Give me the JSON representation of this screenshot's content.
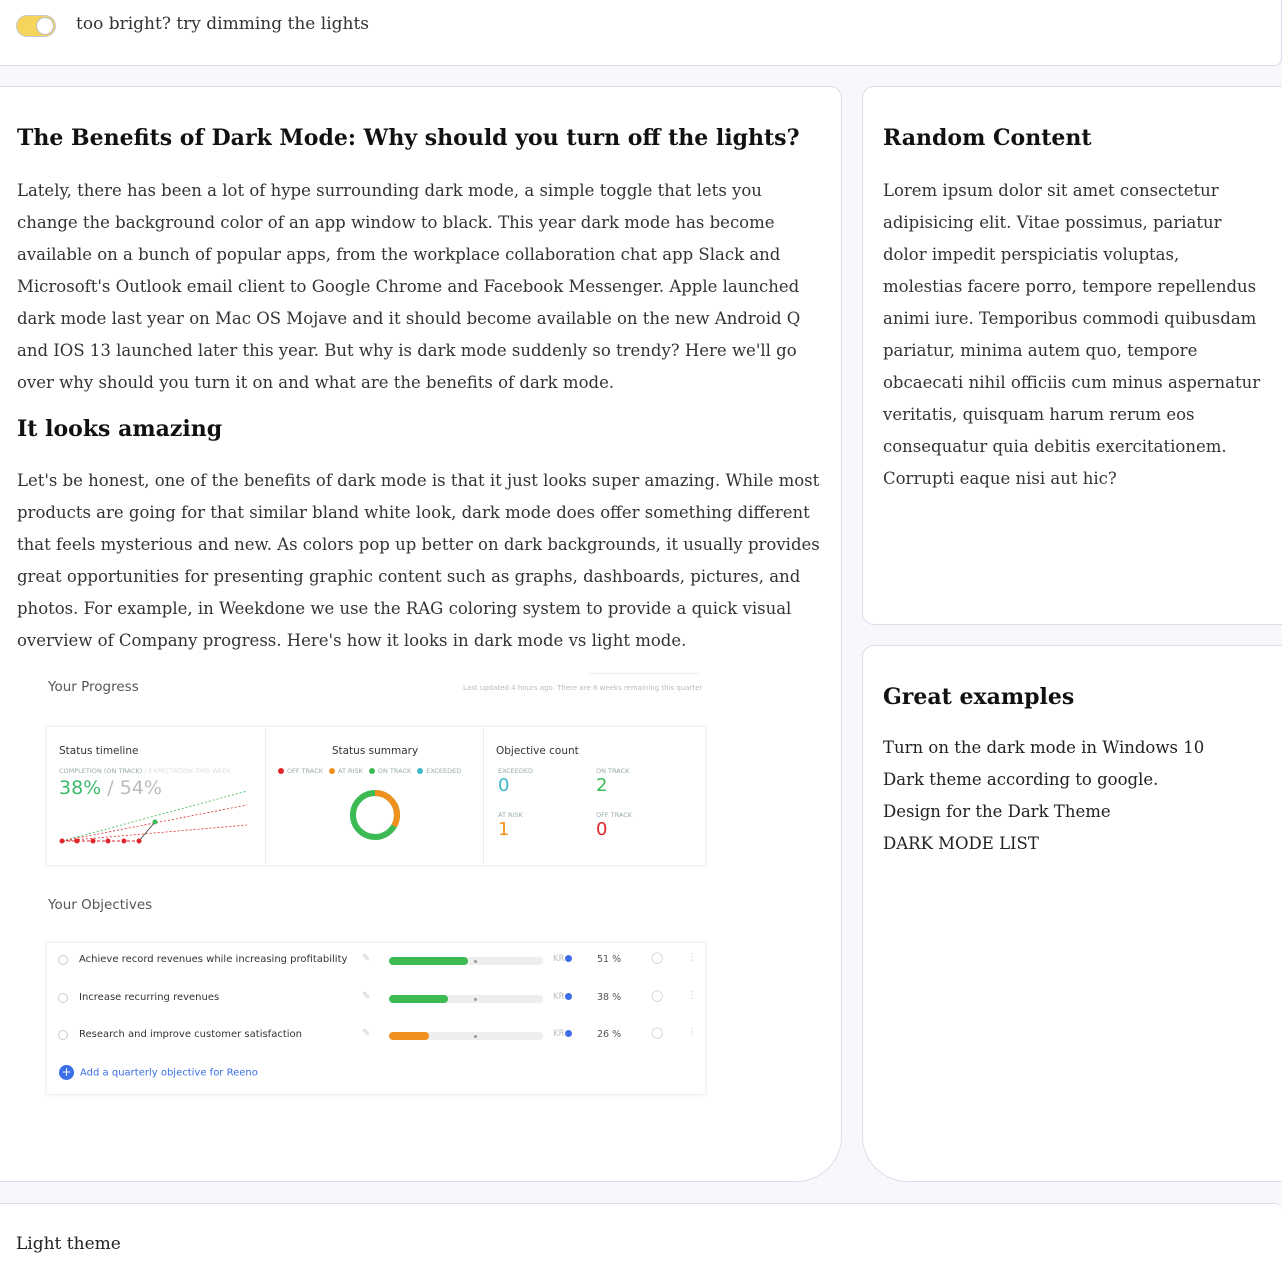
{
  "topbar": {
    "toggle_label": "too bright? try dimming the lights",
    "toggle_on": true
  },
  "main": {
    "title": "The Benefits of Dark Mode: Why should you turn off the lights?",
    "intro": "Lately, there has been a lot of hype surrounding dark mode, a simple toggle that lets you change the background color of an app window to black. This year dark mode has become available on a bunch of popular apps, from the workplace collaboration chat app Slack and Microsoft's Outlook email client to Google Chrome and Facebook Messenger. Apple launched dark mode last year on Mac OS Mojave and it should become available on the new Android Q and IOS 13 launched later this year. But why is dark mode suddenly so trendy? Here we'll go over why should you turn it on and what are the benefits of dark mode.",
    "section_heading": "It looks amazing",
    "section_text": "Let's be honest, one of the benefits of dark mode is that it just looks super amazing. While most products are going for that similar bland white look, dark mode does offer something different that feels mysterious and new. As colors pop up better on dark backgrounds, it usually provides great opportunities for presenting graphic content such as graphs, dashboards, pictures, and photos. For example, in Weekdone we use the RAG coloring system to provide a quick visual overview of Company progress. Here's how it looks in dark mode vs light mode."
  },
  "dashboard": {
    "progress_title": "Your Progress",
    "updated_note": "Last updated 4 hours ago. There are 8 weeks remaining this quarter",
    "status_timeline": {
      "title": "Status timeline",
      "completion_label": "COMPLETION (ON TRACK)",
      "expectation_label": " / EXPECTATION THIS WEEK",
      "completion": "38%",
      "expectation": " / 54%"
    },
    "status_summary": {
      "title": "Status summary",
      "legend": [
        {
          "label": "OFF TRACK",
          "color": "#e0262b"
        },
        {
          "label": "AT RISK",
          "color": "#f0901e"
        },
        {
          "label": "ON TRACK",
          "color": "#3cba54"
        },
        {
          "label": "EXCEEDED",
          "color": "#3cb8c8"
        }
      ],
      "donut": {
        "on_track": 2,
        "at_risk": 1,
        "off_track": 0,
        "exceeded": 0
      }
    },
    "objective_count": {
      "title": "Objective count",
      "cells": [
        {
          "label": "EXCEEDED",
          "value": "0",
          "color": "#3cb8c8"
        },
        {
          "label": "ON TRACK",
          "value": "2",
          "color": "#3cba54"
        },
        {
          "label": "AT RISK",
          "value": "1",
          "color": "#f0901e"
        },
        {
          "label": "OFF TRACK",
          "value": "0",
          "color": "#e0262b"
        }
      ]
    },
    "objectives_title": "Your Objectives",
    "objectives": [
      {
        "name": "Achieve record revenues while increasing profitability",
        "progress": 51,
        "pct": "51 %",
        "kr": "KR",
        "color": "#3cba54"
      },
      {
        "name": "Increase recurring revenues",
        "progress": 38,
        "pct": "38 %",
        "kr": "KR",
        "color": "#3cba54"
      },
      {
        "name": "Research and improve customer satisfaction",
        "progress": 26,
        "pct": "26 %",
        "kr": "KR",
        "color": "#f0901e"
      }
    ],
    "add_objective": "Add a quarterly objective for Reeno"
  },
  "sidebar": {
    "random": {
      "title": "Random Content",
      "text": "Lorem ipsum dolor sit amet consectetur adipisicing elit. Vitae possimus, pariatur dolor impedit perspiciatis voluptas, molestias facere porro, tempore repellendus animi iure. Temporibus commodi quibusdam pariatur, minima autem quo, tempore obcaecati nihil officiis cum minus aspernatur veritatis, quisquam harum rerum eos consequatur quia debitis exercitationem. Corrupti eaque nisi aut hic?"
    },
    "examples": {
      "title": "Great examples",
      "links": [
        "Turn on the dark mode in Windows 10",
        "Dark theme according to google.",
        "Design for the Dark Theme",
        "DARK MODE LIST"
      ]
    }
  },
  "footer": {
    "text": "Light theme"
  }
}
